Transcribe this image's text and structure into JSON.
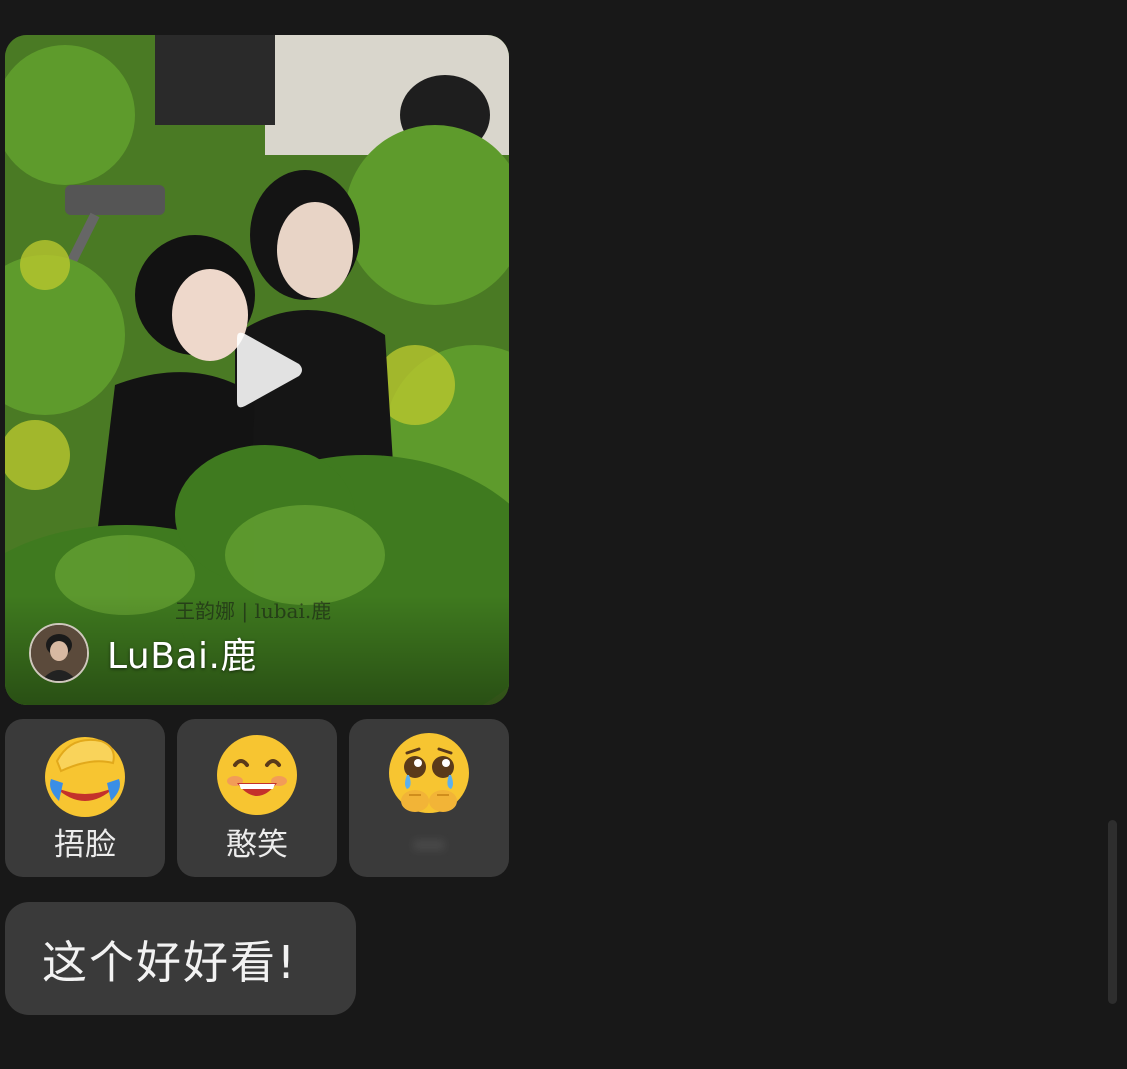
{
  "video": {
    "author_name": "LuBai.鹿",
    "watermark": "王韵娜 | lubai.鹿"
  },
  "reactions": [
    {
      "label": "捂脸",
      "icon": "facepalm-emoji"
    },
    {
      "label": "憨笑",
      "icon": "grin-emoji"
    },
    {
      "label": "…",
      "icon": "teary-eyes-emoji"
    }
  ],
  "message": {
    "text": "这个好好看!"
  }
}
